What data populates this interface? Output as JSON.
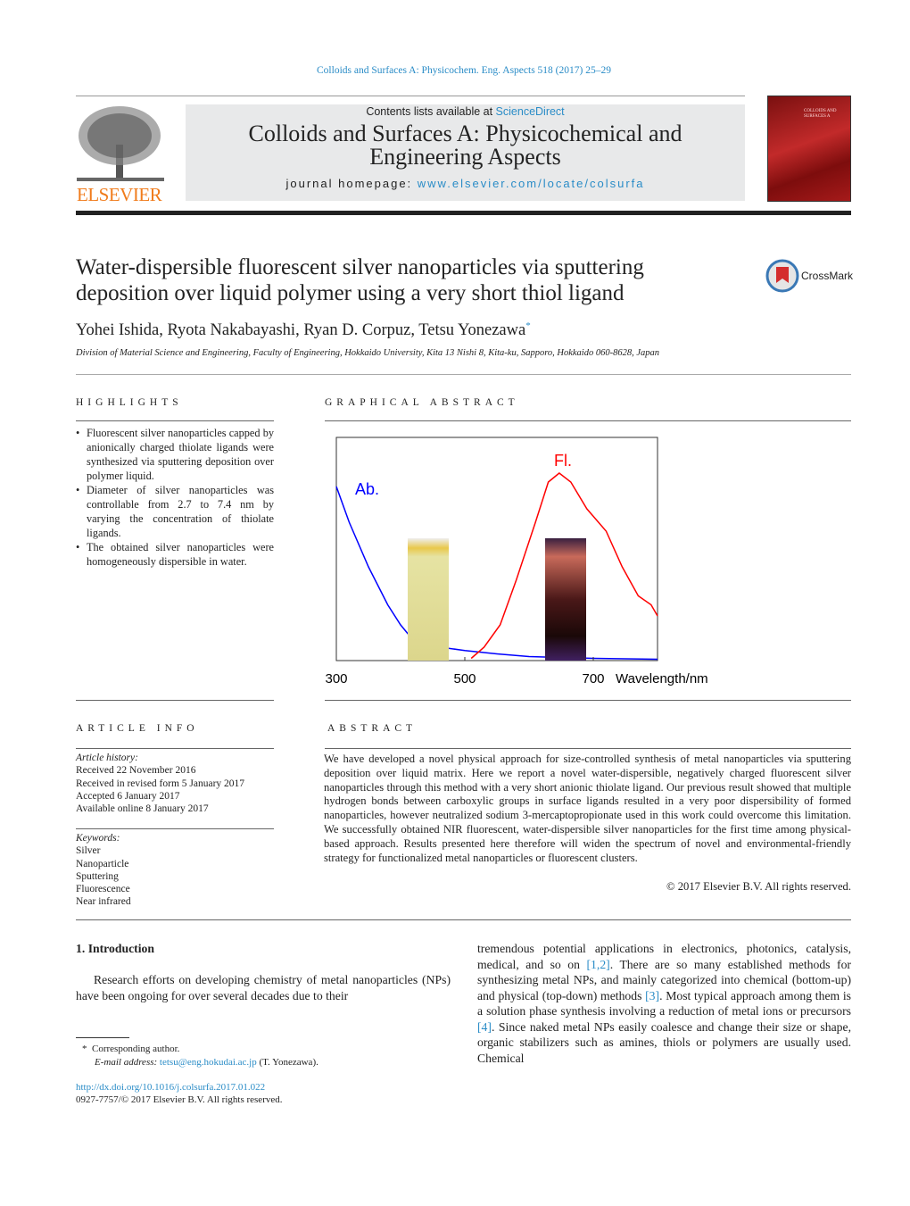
{
  "citation": "Colloids and Surfaces A: Physicochem. Eng. Aspects 518 (2017) 25–29",
  "header": {
    "contents_prefix": "Contents lists available at ",
    "sciencedirect": "ScienceDirect",
    "journal_title_line1": "Colloids and Surfaces A: Physicochemical and",
    "journal_title_line2": "Engineering Aspects",
    "homepage_prefix": "journal homepage: ",
    "homepage_url": "www.elsevier.com/locate/colsurfa",
    "publisher": "ELSEVIER",
    "cover_title": "COLLOIDS AND SURFACES A"
  },
  "article": {
    "title_line1": "Water-dispersible fluorescent silver nanoparticles via sputtering",
    "title_line2": "deposition over liquid polymer using a very short thiol ligand",
    "authors": "Yohei Ishida, Ryota Nakabayashi, Ryan D. Corpuz, Tetsu Yonezawa",
    "author_mark": "*",
    "affiliation": "Division of Material Science and Engineering, Faculty of Engineering, Hokkaido University, Kita 13 Nishi 8, Kita-ku, Sapporo, Hokkaido 060-8628, Japan",
    "crossmark": "CrossMark"
  },
  "highlights": {
    "heading": "HIGHLIGHTS",
    "items": [
      "Fluorescent silver nanoparticles capped by anionically charged thiolate ligands were synthesized via sputtering deposition over polymer liquid.",
      "Diameter of silver nanoparticles was controllable from 2.7 to 7.4 nm by varying the concentration of thiolate ligands.",
      "The obtained silver nanoparticles were homogeneously dispersible in water."
    ]
  },
  "graphical_abstract": {
    "heading": "GRAPHICAL ABSTRACT"
  },
  "chart_data": {
    "type": "line",
    "xlabel": "Wavelength/nm",
    "ylabel": "",
    "xlim": [
      300,
      800
    ],
    "ylim": [
      0,
      1
    ],
    "xticks": [
      "300",
      "500",
      "700"
    ],
    "grid": false,
    "annotations": [
      "Ab.",
      "Fl."
    ],
    "series": [
      {
        "name": "Ab.",
        "color": "#0000ff",
        "x": [
          300,
          320,
          350,
          380,
          400,
          420,
          450,
          500,
          550,
          600,
          700,
          800
        ],
        "y": [
          0.78,
          0.62,
          0.42,
          0.25,
          0.16,
          0.09,
          0.065,
          0.045,
          0.03,
          0.018,
          0.01,
          0.006
        ]
      },
      {
        "name": "Fl.",
        "color": "#ff0000",
        "x": [
          510,
          530,
          555,
          580,
          610,
          630,
          647,
          665,
          690,
          720,
          745,
          770,
          790,
          800
        ],
        "y": [
          0.01,
          0.06,
          0.16,
          0.36,
          0.62,
          0.8,
          0.84,
          0.8,
          0.68,
          0.58,
          0.42,
          0.29,
          0.25,
          0.2
        ]
      }
    ]
  },
  "article_info": {
    "heading": "ARTICLE INFO",
    "history_label": "Article history:",
    "history": [
      "Received 22 November 2016",
      "Received in revised form 5 January 2017",
      "Accepted 6 January 2017",
      "Available online 8 January 2017"
    ],
    "keywords_label": "Keywords:",
    "keywords": [
      "Silver",
      "Nanoparticle",
      "Sputtering",
      "Fluorescence",
      "Near infrared"
    ]
  },
  "abstract": {
    "heading": "ABSTRACT",
    "text": "We have developed a novel physical approach for size-controlled synthesis of metal nanoparticles via sputtering deposition over liquid matrix. Here we report a novel water-dispersible, negatively charged fluorescent silver nanoparticles through this method with a very short anionic thiolate ligand. Our previous result showed that multiple hydrogen bonds between carboxylic groups in surface ligands resulted in a very poor dispersibility of formed nanoparticles, however neutralized sodium 3-mercaptopropionate used in this work could overcome this limitation. We successfully obtained NIR fluorescent, water-dispersible silver nanoparticles for the first time among physical-based approach. Results presented here therefore will widen the spectrum of novel and environmental-friendly strategy for functionalized metal nanoparticles or fluorescent clusters.",
    "copyright": "© 2017 Elsevier B.V. All rights reserved."
  },
  "intro": {
    "heading": "1.  Introduction",
    "p1": "Research efforts on developing chemistry of metal nanoparticles (NPs) have been ongoing for over several decades due to their",
    "p2_a": "tremendous potential applications in electronics, photonics, catalysis, medical, and so on ",
    "ref1": "[1,2]",
    "p2_b": ". There are so many established methods for synthesizing metal NPs, and mainly categorized into chemical (bottom-up) and physical (top-down) methods ",
    "ref2": "[3]",
    "p2_c": ". Most typical approach among them is a solution phase synthesis involving a reduction of metal ions or precursors ",
    "ref3": "[4]",
    "p2_d": ". Since naked metal NPs easily coalesce and change their size or shape, organic stabilizers such as amines, thiols or polymers are usually used. Chemical"
  },
  "footnote": {
    "mark": "*",
    "corresponding": "Corresponding author.",
    "email_label": "E-mail address: ",
    "email": "tetsu@eng.hokudai.ac.jp",
    "email_suffix": " (T. Yonezawa)."
  },
  "doi": "http://dx.doi.org/10.1016/j.colsurfa.2017.01.022",
  "issn": "0927-7757/© 2017 Elsevier B.V. All rights reserved."
}
